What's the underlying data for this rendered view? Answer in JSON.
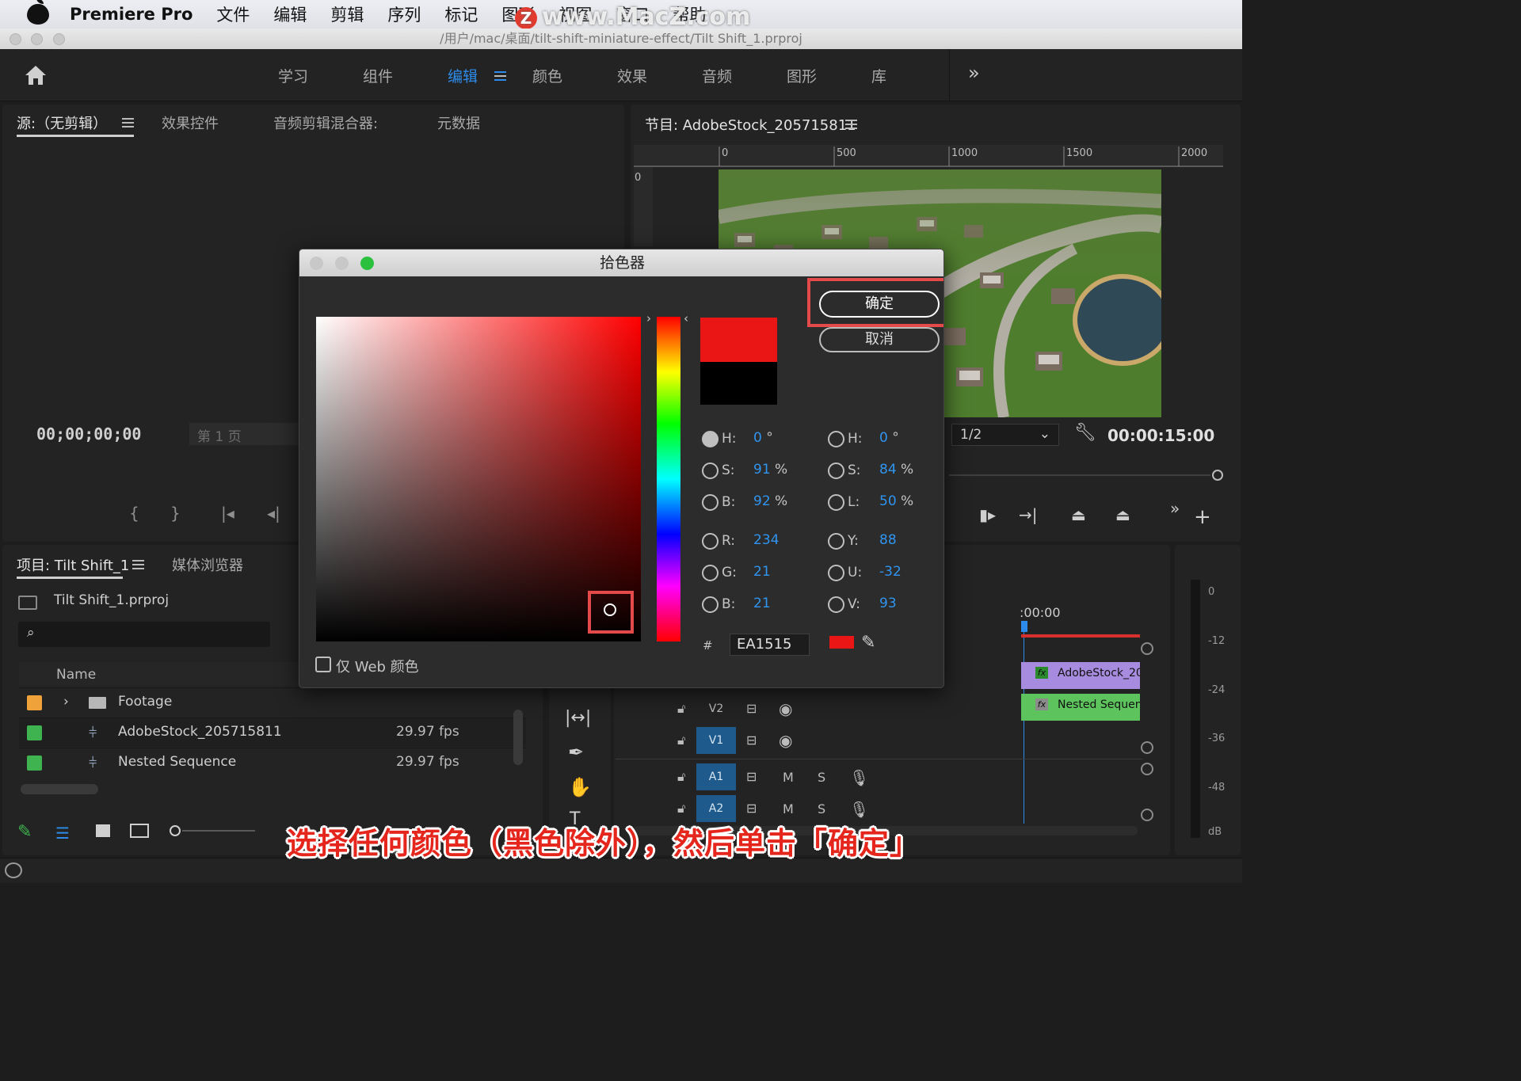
{
  "menubar": {
    "app_name": "Premiere Pro",
    "items": [
      "文件",
      "编辑",
      "剪辑",
      "序列",
      "标记",
      "图形",
      "视图",
      "窗口",
      "帮助"
    ]
  },
  "watermark": {
    "logo": "Z",
    "text": "www.MacZ.com"
  },
  "window": {
    "title_path": "/用户/mac/桌面/tilt-shift-miniature-effect/Tilt Shift_1.prproj"
  },
  "workspaces": {
    "items": [
      "学习",
      "组件",
      "编辑",
      "颜色",
      "效果",
      "音频",
      "图形",
      "库"
    ],
    "active": "编辑",
    "overflow_label": "»"
  },
  "source_panel": {
    "tabs": [
      "源:（无剪辑）",
      "效果控件",
      "音频剪辑混合器:",
      "元数据"
    ],
    "timecode": "00;00;00;00",
    "page_label": "第 1 页"
  },
  "program_panel": {
    "title": "节目: AdobeStock_205715811",
    "ruler_labels": [
      "0",
      "500",
      "1000",
      "1500",
      "2000"
    ],
    "vruler_label": "0",
    "resolution": "1/2",
    "timecode": "00:00:15:00"
  },
  "project_panel": {
    "tabs": [
      "项目: Tilt Shift_1",
      "媒体浏览器"
    ],
    "project_file": "Tilt Shift_1.prproj",
    "search_placeholder": "",
    "column_name": "Name",
    "rows": [
      {
        "name": "Footage",
        "color": "#f0a23a",
        "type": "folder",
        "fps": ""
      },
      {
        "name": "AdobeStock_205715811",
        "color": "#3fb34f",
        "type": "sequence",
        "fps": "29.97 fps"
      },
      {
        "name": "Nested Sequence",
        "color": "#3fb34f",
        "type": "sequence",
        "fps": "29.97 fps"
      }
    ]
  },
  "timeline": {
    "timecode": ":00:00",
    "tracks": [
      {
        "label": "V2",
        "active": false,
        "m": "",
        "s": ""
      },
      {
        "label": "V1",
        "active": true,
        "m": "",
        "s": ""
      },
      {
        "label": "A1",
        "active": true,
        "m": "M",
        "s": "S"
      },
      {
        "label": "A2",
        "active": true,
        "m": "M",
        "s": "S"
      }
    ],
    "clips": [
      {
        "name": "AdobeStock_20",
        "color": "#a78bde"
      },
      {
        "name": "Nested Sequenc",
        "color": "#5dc35d"
      }
    ]
  },
  "audio_meter": {
    "labels": [
      "0",
      "-12",
      "-24",
      "-36",
      "-48",
      "dB"
    ]
  },
  "color_picker": {
    "title": "拾色器",
    "ok_label": "确定",
    "cancel_label": "取消",
    "new_color": "#EA1515",
    "old_color": "#000000",
    "fields_left": [
      {
        "label": "H:",
        "value": "0",
        "unit": "°",
        "selected": true
      },
      {
        "label": "S:",
        "value": "91",
        "unit": "%",
        "selected": false
      },
      {
        "label": "B:",
        "value": "92",
        "unit": "%",
        "selected": false
      },
      {
        "label": "R:",
        "value": "234",
        "unit": "",
        "selected": false
      },
      {
        "label": "G:",
        "value": "21",
        "unit": "",
        "selected": false
      },
      {
        "label": "B:",
        "value": "21",
        "unit": "",
        "selected": false
      }
    ],
    "fields_right": [
      {
        "label": "H:",
        "value": "0",
        "unit": "°",
        "selected": false
      },
      {
        "label": "S:",
        "value": "84",
        "unit": "%",
        "selected": false
      },
      {
        "label": "L:",
        "value": "50",
        "unit": "%",
        "selected": false
      },
      {
        "label": "Y:",
        "value": "88",
        "unit": "",
        "selected": false
      },
      {
        "label": "U:",
        "value": "-32",
        "unit": "",
        "selected": false
      },
      {
        "label": "V:",
        "value": "93",
        "unit": "",
        "selected": false
      }
    ],
    "hex_prefix": "#",
    "hex_value": "EA1515",
    "web_only_label": "仅 Web 颜色",
    "web_only_checked": false,
    "accent_highlight": "#e44a4a"
  },
  "caption": "选择任何颜色（黑色除外），然后单击「确定」"
}
